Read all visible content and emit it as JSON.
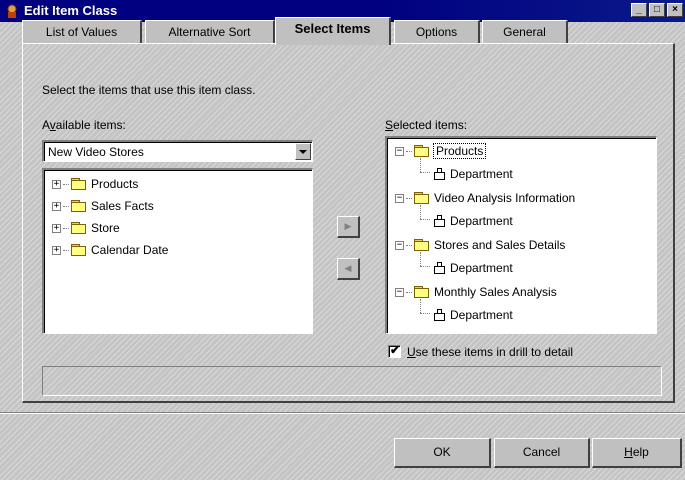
{
  "window": {
    "title": "Edit Item Class"
  },
  "title_buttons": {
    "minimize": "_",
    "maximize": "□",
    "close": "×"
  },
  "tabs": [
    {
      "label": "List of Values"
    },
    {
      "label": "Alternative Sort"
    },
    {
      "label": "Select Items",
      "active": true
    },
    {
      "label": "Options"
    },
    {
      "label": "General"
    }
  ],
  "instructions": "Select the items that use this item class.",
  "available": {
    "label_prefix": "A",
    "label_accel": "v",
    "label_rest": "ailable items:",
    "combo_value": "New Video Stores",
    "items": [
      {
        "label": "Products",
        "expander": "+"
      },
      {
        "label": "Sales Facts",
        "expander": "+"
      },
      {
        "label": "Store",
        "expander": "+"
      },
      {
        "label": "Calendar Date",
        "expander": "+"
      }
    ]
  },
  "move_buttons": {
    "add": "▶",
    "remove": "◀"
  },
  "selected": {
    "label_accel": "S",
    "label_rest": "elected items:",
    "items": [
      {
        "label": "Products",
        "expander": "−",
        "child": "Department"
      },
      {
        "label": "Video Analysis Information",
        "expander": "−",
        "child": "Department"
      },
      {
        "label": "Stores and Sales Details",
        "expander": "−",
        "child": "Department"
      },
      {
        "label": "Monthly Sales Analysis",
        "expander": "−",
        "child": "Department"
      }
    ]
  },
  "drill_checkbox": {
    "accel": "U",
    "label_rest": "se these items in drill to detail",
    "checked": true,
    "mark": "✔"
  },
  "buttons": {
    "ok": "OK",
    "cancel": "Cancel",
    "help_accel": "H",
    "help_rest": "elp"
  },
  "colors": {
    "titlebar": "#000080",
    "face": "#c0c0c0"
  }
}
